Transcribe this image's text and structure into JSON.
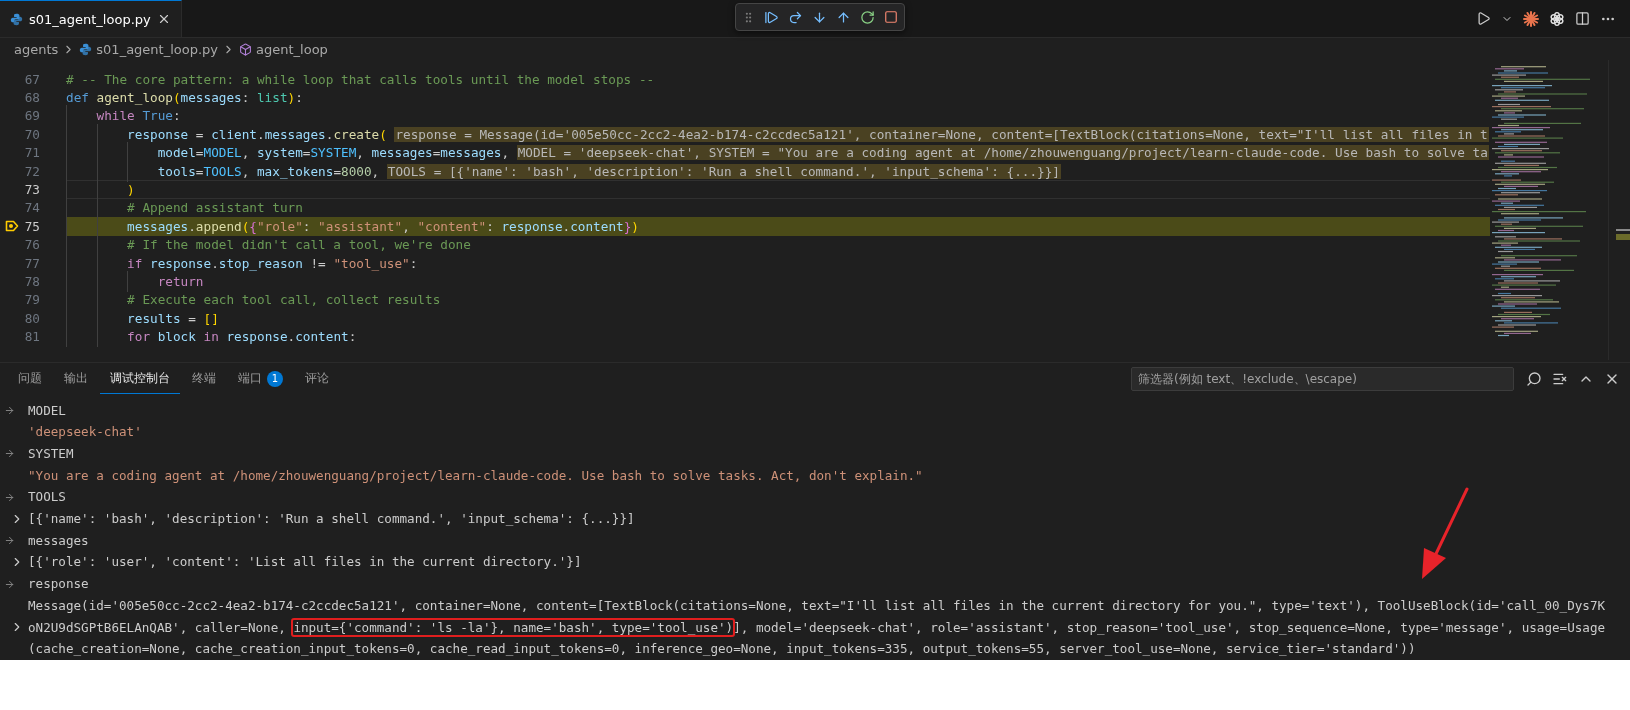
{
  "editor_tab": {
    "label": "s01_agent_loop.py",
    "selected": true
  },
  "breadcrumb": [
    {
      "kind": "folder",
      "label": "agents"
    },
    {
      "kind": "file",
      "label": "s01_agent_loop.py"
    },
    {
      "kind": "function",
      "label": "agent_loop"
    }
  ],
  "code_lines": [
    {
      "number": "67",
      "paused": false,
      "cursor": false,
      "tokens": [
        {
          "kind": "comment",
          "text": "# -- The core pattern: a while loop that calls tools until the model stops --"
        }
      ]
    },
    {
      "number": "68",
      "paused": false,
      "cursor": false,
      "tokens": [
        {
          "kind": "keyword",
          "text": "def "
        },
        {
          "kind": "function",
          "text": "agent_loop"
        },
        {
          "kind": "bracket",
          "text": "("
        },
        {
          "kind": "variable",
          "text": "messages"
        },
        {
          "kind": "plain",
          "text": ": "
        },
        {
          "kind": "type",
          "text": "list"
        },
        {
          "kind": "bracket",
          "text": ")"
        },
        {
          "kind": "plain",
          "text": ":"
        }
      ]
    },
    {
      "number": "69",
      "paused": false,
      "cursor": false,
      "tokens": [
        {
          "kind": "control",
          "text": "    while "
        },
        {
          "kind": "keyword",
          "text": "True"
        },
        {
          "kind": "plain",
          "text": ":"
        }
      ]
    },
    {
      "number": "70",
      "paused": false,
      "cursor": false,
      "tokens": [
        {
          "kind": "variable",
          "text": "        response"
        },
        {
          "kind": "plain",
          "text": " = "
        },
        {
          "kind": "variable",
          "text": "client"
        },
        {
          "kind": "plain",
          "text": "."
        },
        {
          "kind": "variable",
          "text": "messages"
        },
        {
          "kind": "plain",
          "text": "."
        },
        {
          "kind": "function",
          "text": "create"
        },
        {
          "kind": "bracket",
          "text": "("
        }
      ],
      "inline_value": "response = Message(id='005e50cc-2cc2-4ea2-b174-c2ccdec5a121', container=None, content=[TextBlock(citations=None, text=\"I'll list all files in t"
    },
    {
      "number": "71",
      "paused": false,
      "cursor": false,
      "tokens": [
        {
          "kind": "variable",
          "text": "            model"
        },
        {
          "kind": "plain",
          "text": "="
        },
        {
          "kind": "constant",
          "text": "MODEL"
        },
        {
          "kind": "plain",
          "text": ", "
        },
        {
          "kind": "variable",
          "text": "system"
        },
        {
          "kind": "plain",
          "text": "="
        },
        {
          "kind": "constant",
          "text": "SYSTEM"
        },
        {
          "kind": "plain",
          "text": ", "
        },
        {
          "kind": "variable",
          "text": "messages"
        },
        {
          "kind": "plain",
          "text": "="
        },
        {
          "kind": "variable",
          "text": "messages"
        },
        {
          "kind": "plain",
          "text": ","
        }
      ],
      "inline_value": "MODEL = 'deepseek-chat', SYSTEM = \"You are a coding agent at /home/zhouwenguang/project/learn-claude-code. Use bash to solve ta"
    },
    {
      "number": "72",
      "paused": false,
      "cursor": false,
      "tokens": [
        {
          "kind": "variable",
          "text": "            tools"
        },
        {
          "kind": "plain",
          "text": "="
        },
        {
          "kind": "constant",
          "text": "TOOLS"
        },
        {
          "kind": "plain",
          "text": ", "
        },
        {
          "kind": "variable",
          "text": "max_tokens"
        },
        {
          "kind": "plain",
          "text": "="
        },
        {
          "kind": "number",
          "text": "8000"
        },
        {
          "kind": "plain",
          "text": ","
        }
      ],
      "inline_value": "TOOLS = [{'name': 'bash', 'description': 'Run a shell command.', 'input_schema': {...}}]"
    },
    {
      "number": "73",
      "paused": false,
      "cursor": true,
      "tokens": [
        {
          "kind": "bracket",
          "text": "        )"
        }
      ]
    },
    {
      "number": "74",
      "paused": false,
      "cursor": false,
      "tokens": [
        {
          "kind": "comment",
          "text": "        # Append assistant turn"
        }
      ]
    },
    {
      "number": "75",
      "paused": true,
      "cursor": false,
      "tokens": [
        {
          "kind": "variable",
          "text": "        messages"
        },
        {
          "kind": "plain",
          "text": "."
        },
        {
          "kind": "function",
          "text": "append"
        },
        {
          "kind": "bracket",
          "text": "("
        },
        {
          "kind": "brace",
          "text": "{"
        },
        {
          "kind": "string",
          "text": "\"role\""
        },
        {
          "kind": "plain",
          "text": ": "
        },
        {
          "kind": "string",
          "text": "\"assistant\""
        },
        {
          "kind": "plain",
          "text": ", "
        },
        {
          "kind": "string",
          "text": "\"content\""
        },
        {
          "kind": "plain",
          "text": ": "
        },
        {
          "kind": "variable",
          "text": "response"
        },
        {
          "kind": "plain",
          "text": "."
        },
        {
          "kind": "variable",
          "text": "content"
        },
        {
          "kind": "brace",
          "text": "}"
        },
        {
          "kind": "bracket",
          "text": ")"
        }
      ]
    },
    {
      "number": "76",
      "paused": false,
      "cursor": false,
      "tokens": [
        {
          "kind": "comment",
          "text": "        # If the model didn't call a tool, we're done"
        }
      ]
    },
    {
      "number": "77",
      "paused": false,
      "cursor": false,
      "tokens": [
        {
          "kind": "control",
          "text": "        if "
        },
        {
          "kind": "variable",
          "text": "response"
        },
        {
          "kind": "plain",
          "text": "."
        },
        {
          "kind": "variable",
          "text": "stop_reason"
        },
        {
          "kind": "plain",
          "text": " != "
        },
        {
          "kind": "string",
          "text": "\"tool_use\""
        },
        {
          "kind": "plain",
          "text": ":"
        }
      ]
    },
    {
      "number": "78",
      "paused": false,
      "cursor": false,
      "tokens": [
        {
          "kind": "control",
          "text": "            return"
        }
      ]
    },
    {
      "number": "79",
      "paused": false,
      "cursor": false,
      "tokens": [
        {
          "kind": "comment",
          "text": "        # Execute each tool call, collect results"
        }
      ]
    },
    {
      "number": "80",
      "paused": false,
      "cursor": false,
      "tokens": [
        {
          "kind": "variable",
          "text": "        results"
        },
        {
          "kind": "plain",
          "text": " = "
        },
        {
          "kind": "bracket",
          "text": "[]"
        }
      ]
    },
    {
      "number": "81",
      "paused": false,
      "cursor": false,
      "tokens": [
        {
          "kind": "control",
          "text": "        for "
        },
        {
          "kind": "variable",
          "text": "block "
        },
        {
          "kind": "control",
          "text": "in "
        },
        {
          "kind": "variable",
          "text": "response"
        },
        {
          "kind": "plain",
          "text": "."
        },
        {
          "kind": "variable",
          "text": "content"
        },
        {
          "kind": "plain",
          "text": ":"
        }
      ]
    }
  ],
  "panel": {
    "tabs": [
      {
        "label": "问题",
        "selected": false
      },
      {
        "label": "输出",
        "selected": false
      },
      {
        "label": "调试控制台",
        "selected": true
      },
      {
        "label": "终端",
        "selected": false
      },
      {
        "label": "端口",
        "selected": false,
        "badge": "1"
      },
      {
        "label": "评论",
        "selected": false
      }
    ],
    "filter": {
      "placeholder": "筛选器(例如 text、!exclude、\\escape)"
    }
  },
  "console": [
    {
      "kind": "input",
      "text": "MODEL"
    },
    {
      "kind": "output",
      "color": "#ce9178",
      "expandable": false,
      "lines": [
        [
          {
            "text": "'deepseek-chat'",
            "boxed": false
          }
        ]
      ]
    },
    {
      "kind": "input",
      "text": "SYSTEM"
    },
    {
      "kind": "output",
      "color": "#ce9178",
      "expandable": false,
      "lines": [
        [
          {
            "text": "\"You are a coding agent at /home/zhouwenguang/project/learn-claude-code. Use bash to solve tasks. Act, don't explain.\"",
            "boxed": false
          }
        ]
      ]
    },
    {
      "kind": "input",
      "text": "TOOLS"
    },
    {
      "kind": "output",
      "color": "#cccccc",
      "expandable": true,
      "lines": [
        [
          {
            "text": "[{'name': 'bash', 'description': 'Run a shell command.', 'input_schema': {...}}]",
            "boxed": false
          }
        ]
      ]
    },
    {
      "kind": "input",
      "text": "messages"
    },
    {
      "kind": "output",
      "color": "#cccccc",
      "expandable": true,
      "lines": [
        [
          {
            "text": "[{'role': 'user', 'content': 'List all files in the current directory.'}]",
            "boxed": false
          }
        ]
      ]
    },
    {
      "kind": "input",
      "text": "response"
    },
    {
      "kind": "output",
      "color": "#cccccc",
      "expandable": true,
      "lines": [
        [
          {
            "text": "Message(id='005e50cc-2cc2-4ea2-b174-c2ccdec5a121', container=None, content=[TextBlock(citations=None, text=\"I'll list all files in the current directory for you.\", type='text'), ToolUseBlock(id='call_00_Dys7K",
            "boxed": false
          }
        ],
        [
          {
            "text": "oN2U9dSGPtB6ELAnQAB', caller=None, ",
            "boxed": false
          },
          {
            "text": "input={'command': 'ls -la'}, name='bash', type='tool_use')",
            "boxed": true
          },
          {
            "text": "], model='deepseek-chat', role='assistant', stop_reason='tool_use', stop_sequence=None, type='message', usage=Usage",
            "boxed": false
          }
        ],
        [
          {
            "text": "(cache_creation=None, cache_creation_input_tokens=0, cache_read_input_tokens=0, inference_geo=None, input_tokens=335, output_tokens=55, server_tool_use=None, service_tier='standard'))",
            "boxed": false
          }
        ]
      ]
    }
  ]
}
